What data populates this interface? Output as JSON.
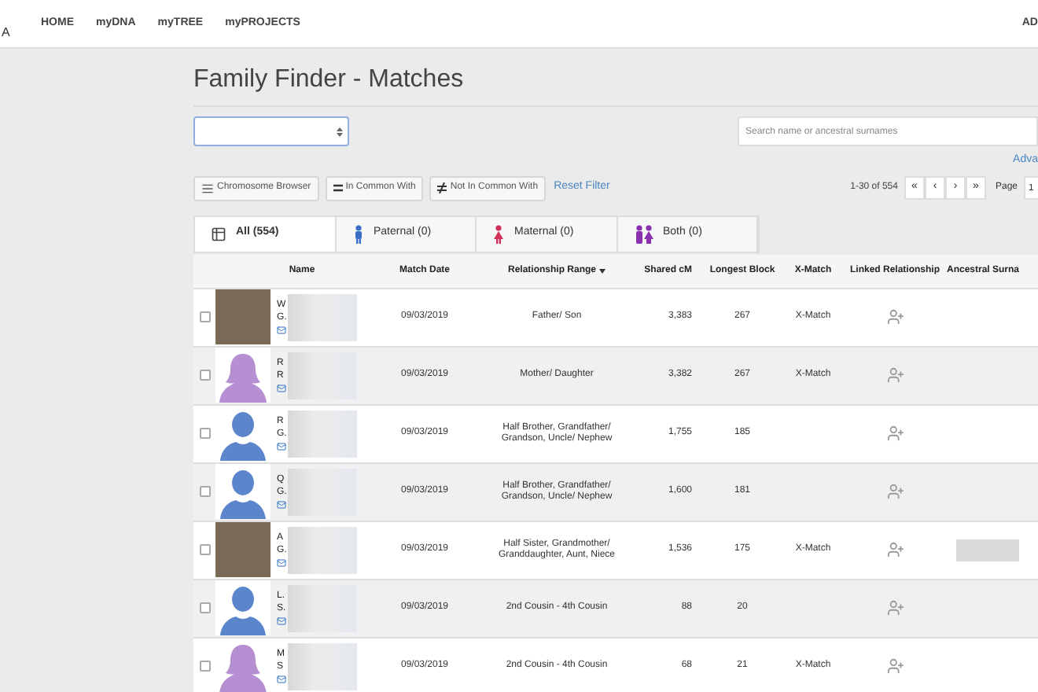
{
  "header": {
    "logo_fragment": "A",
    "nav": [
      {
        "label": "HOME"
      },
      {
        "label": "myDNA"
      },
      {
        "label": "myTREE"
      },
      {
        "label": "myPROJECTS"
      }
    ],
    "right_fragment": "AD"
  },
  "page_title": "Family Finder - Matches",
  "search": {
    "placeholder": "Search name or ancestral surnames"
  },
  "advanced_link": "Adva",
  "toolbar": {
    "buttons": [
      {
        "kind": "chromosome",
        "label": "Chromosome Browser"
      },
      {
        "kind": "equal",
        "label": "In Common With"
      },
      {
        "kind": "notequal",
        "label": "Not In Common With"
      }
    ],
    "reset": "Reset Filter"
  },
  "pagination": {
    "range": "1-30 of 554",
    "buttons": [
      "«",
      "‹",
      "›",
      "»"
    ],
    "page_label": "Page",
    "page_value": "1"
  },
  "tabs": [
    {
      "kind": "all",
      "label": "All (554)",
      "selected": true
    },
    {
      "kind": "paternal",
      "label": "Paternal (0)",
      "selected": false
    },
    {
      "kind": "maternal",
      "label": "Maternal (0)",
      "selected": false
    },
    {
      "kind": "both",
      "label": "Both (0)",
      "selected": false
    }
  ],
  "table": {
    "columns": [
      {
        "label": "Name",
        "sorted": false
      },
      {
        "label": "Match Date",
        "sorted": false
      },
      {
        "label": "Relationship Range",
        "sorted": true
      },
      {
        "label": "Shared cM",
        "sorted": false
      },
      {
        "label": "Longest Block",
        "sorted": false
      },
      {
        "label": "X-Match",
        "sorted": false
      },
      {
        "label": "Linked Relationship",
        "sorted": false
      },
      {
        "label": "Ancestral Surna",
        "sorted": false
      }
    ],
    "rows": [
      {
        "checked": false,
        "kind": "photo",
        "name_line_1": "W",
        "name_line_2": "G.",
        "match_date": "09/03/2019",
        "relationship": "Father/ Son",
        "shared_cm": "3,383",
        "longest_block": "267",
        "x_match": "X-Match",
        "ancestral_redacted": false
      },
      {
        "checked": false,
        "kind": "female",
        "name_line_1": "R",
        "name_line_2": "R",
        "match_date": "09/03/2019",
        "relationship": "Mother/ Daughter",
        "shared_cm": "3,382",
        "longest_block": "267",
        "x_match": "X-Match",
        "ancestral_redacted": false
      },
      {
        "checked": false,
        "kind": "male",
        "name_line_1": "R",
        "name_line_2": "G.",
        "match_date": "09/03/2019",
        "relationship": "Half Brother, Grandfather/ Grandson, Uncle/ Nephew",
        "shared_cm": "1,755",
        "longest_block": "185",
        "ancestral_redacted": false
      },
      {
        "checked": false,
        "kind": "male",
        "name_line_1": "Q",
        "name_line_2": "G.",
        "match_date": "09/03/2019",
        "relationship": "Half Brother, Grandfather/ Grandson, Uncle/ Nephew",
        "shared_cm": "1,600",
        "longest_block": "181",
        "ancestral_redacted": false
      },
      {
        "checked": false,
        "kind": "photo",
        "name_line_1": "A",
        "name_line_2": "G.",
        "match_date": "09/03/2019",
        "relationship": "Half Sister, Grandmother/ Granddaughter, Aunt, Niece",
        "shared_cm": "1,536",
        "longest_block": "175",
        "x_match": "X-Match",
        "ancestral_redacted": true
      },
      {
        "checked": false,
        "kind": "male",
        "name_line_1": "L.",
        "name_line_2": "S.",
        "match_date": "09/03/2019",
        "relationship": "2nd Cousin - 4th Cousin",
        "shared_cm": "88",
        "longest_block": "20",
        "ancestral_redacted": false
      },
      {
        "checked": false,
        "kind": "female",
        "name_line_1": "M",
        "name_line_2": "S",
        "match_date": "09/03/2019",
        "relationship": "2nd Cousin - 4th Cousin",
        "shared_cm": "68",
        "longest_block": "21",
        "x_match": "X-Match",
        "ancestral_redacted": false
      }
    ]
  }
}
